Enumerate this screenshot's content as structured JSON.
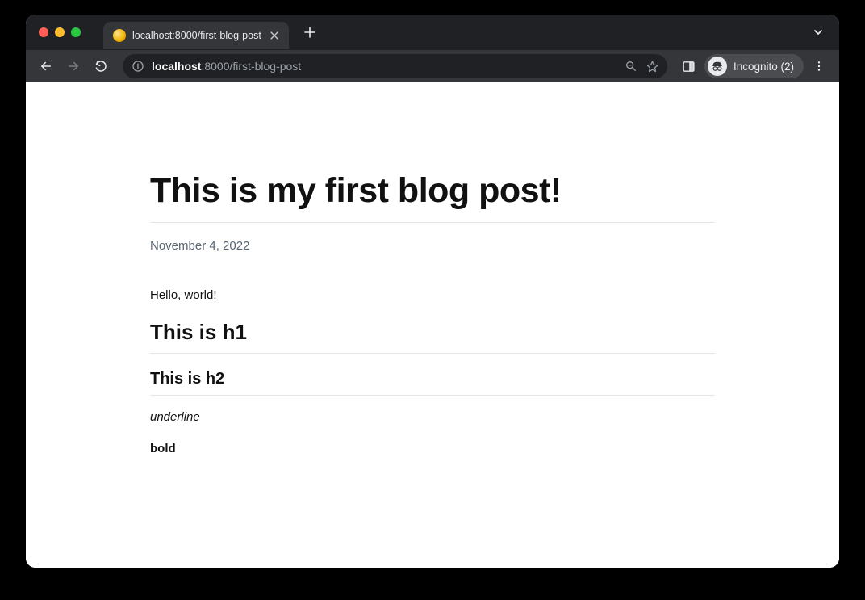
{
  "browser": {
    "tab": {
      "title": "localhost:8000/first-blog-post"
    },
    "url": {
      "host": "localhost",
      "port_path": ":8000/first-blog-post"
    },
    "incognito_label": "Incognito (2)"
  },
  "post": {
    "title": "This is my first blog post!",
    "date": "November 4, 2022",
    "body": {
      "hello": "Hello, world!",
      "h1": "This is h1",
      "h2": "This is h2",
      "underline": "underline",
      "bold": "bold"
    }
  }
}
